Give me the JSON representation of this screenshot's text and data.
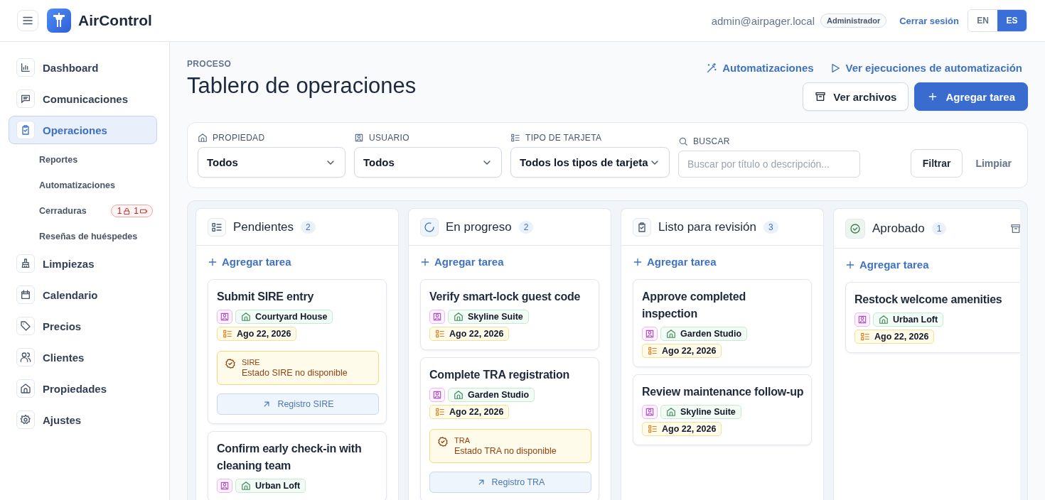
{
  "app": {
    "name": "AirControl"
  },
  "header": {
    "email": "admin@airpager.local",
    "role": "Administrador",
    "logout": "Cerrar sesión",
    "languages": [
      {
        "label": "EN",
        "selected": false
      },
      {
        "label": "ES",
        "selected": true
      }
    ]
  },
  "sidebar": {
    "items": [
      {
        "label": "Dashboard",
        "selected": false
      },
      {
        "label": "Comunicaciones",
        "selected": false
      },
      {
        "label": "Operaciones",
        "selected": true,
        "children": [
          {
            "label": "Reportes"
          },
          {
            "label": "Automatizaciones"
          },
          {
            "label": "Cerraduras",
            "badge": {
              "locks": "1",
              "batteries": "1"
            }
          },
          {
            "label": "Reseñas de huéspedes"
          }
        ]
      },
      {
        "label": "Limpiezas",
        "selected": false
      },
      {
        "label": "Calendario",
        "selected": false
      },
      {
        "label": "Precios",
        "selected": false
      },
      {
        "label": "Clientes",
        "selected": false
      },
      {
        "label": "Propiedades",
        "selected": false
      },
      {
        "label": "Ajustes",
        "selected": false
      }
    ]
  },
  "page": {
    "eyebrow": "PROCESO",
    "title": "Tablero de operaciones",
    "links": [
      "Automatizaciones",
      "Ver ejecuciones de automatización"
    ],
    "buttons": [
      {
        "label": "Ver archivos",
        "kind": "secondary"
      },
      {
        "label": "Agregar tarea",
        "kind": "primary"
      }
    ]
  },
  "filters": {
    "selects": [
      {
        "label": "PROPIEDAD",
        "value": "Todos"
      },
      {
        "label": "USUARIO",
        "value": "Todos"
      },
      {
        "label": "TIPO DE TARJETA",
        "value": "Todos los tipos de tarjeta"
      }
    ],
    "search": {
      "label": "BUSCAR",
      "placeholder": "Buscar por título o descripción..."
    },
    "apply": "Filtrar",
    "clear": "Limpiar"
  },
  "board": {
    "columns": [
      {
        "kind": "pending",
        "title": "Pendientes",
        "count": "2",
        "add": "Agregar tarea",
        "cards": [
          {
            "title": "Submit SIRE entry",
            "property": "Courtyard House",
            "date": "Ago 22, 2026",
            "alert": {
              "label": "SIRE",
              "message": "Estado SIRE no disponible"
            },
            "action": "Registro SIRE"
          },
          {
            "title": "Confirm early check-in with cleaning team",
            "property": "Urban Loft"
          }
        ]
      },
      {
        "kind": "progress",
        "title": "En progreso",
        "count": "2",
        "add": "Agregar tarea",
        "cards": [
          {
            "title": "Verify smart-lock guest code",
            "property": "Skyline Suite",
            "date": "Ago 22, 2026"
          },
          {
            "title": "Complete TRA registration",
            "property": "Garden Studio",
            "date": "Ago 22, 2026",
            "alert": {
              "label": "TRA",
              "message": "Estado TRA no disponible"
            },
            "action": "Registro TRA"
          }
        ]
      },
      {
        "kind": "review",
        "title": "Listo para revisión",
        "count": "3",
        "add": "Agregar tarea",
        "cards": [
          {
            "title": "Approve completed inspection",
            "property": "Garden Studio",
            "date": "Ago 22, 2026"
          },
          {
            "title": "Review maintenance follow-up",
            "property": "Skyline Suite",
            "date": "Ago 22, 2026"
          }
        ]
      },
      {
        "kind": "approved",
        "title": "Aprobado",
        "count": "1",
        "add": "Agregar tarea",
        "cards": [
          {
            "title": "Restock welcome amenities",
            "property": "Urban Loft",
            "date": "Ago 22, 2026"
          }
        ]
      }
    ]
  }
}
